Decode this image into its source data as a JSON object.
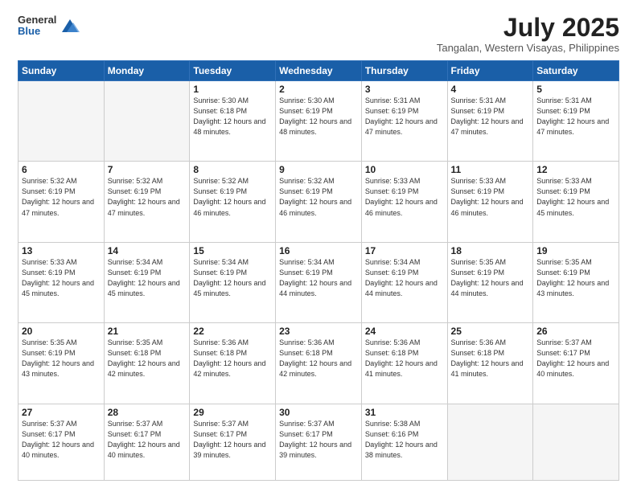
{
  "logo": {
    "general": "General",
    "blue": "Blue"
  },
  "header": {
    "month_year": "July 2025",
    "location": "Tangalan, Western Visayas, Philippines"
  },
  "weekdays": [
    "Sunday",
    "Monday",
    "Tuesday",
    "Wednesday",
    "Thursday",
    "Friday",
    "Saturday"
  ],
  "weeks": [
    [
      {
        "day": "",
        "info": ""
      },
      {
        "day": "",
        "info": ""
      },
      {
        "day": "1",
        "info": "Sunrise: 5:30 AM\nSunset: 6:18 PM\nDaylight: 12 hours and 48 minutes."
      },
      {
        "day": "2",
        "info": "Sunrise: 5:30 AM\nSunset: 6:19 PM\nDaylight: 12 hours and 48 minutes."
      },
      {
        "day": "3",
        "info": "Sunrise: 5:31 AM\nSunset: 6:19 PM\nDaylight: 12 hours and 47 minutes."
      },
      {
        "day": "4",
        "info": "Sunrise: 5:31 AM\nSunset: 6:19 PM\nDaylight: 12 hours and 47 minutes."
      },
      {
        "day": "5",
        "info": "Sunrise: 5:31 AM\nSunset: 6:19 PM\nDaylight: 12 hours and 47 minutes."
      }
    ],
    [
      {
        "day": "6",
        "info": "Sunrise: 5:32 AM\nSunset: 6:19 PM\nDaylight: 12 hours and 47 minutes."
      },
      {
        "day": "7",
        "info": "Sunrise: 5:32 AM\nSunset: 6:19 PM\nDaylight: 12 hours and 47 minutes."
      },
      {
        "day": "8",
        "info": "Sunrise: 5:32 AM\nSunset: 6:19 PM\nDaylight: 12 hours and 46 minutes."
      },
      {
        "day": "9",
        "info": "Sunrise: 5:32 AM\nSunset: 6:19 PM\nDaylight: 12 hours and 46 minutes."
      },
      {
        "day": "10",
        "info": "Sunrise: 5:33 AM\nSunset: 6:19 PM\nDaylight: 12 hours and 46 minutes."
      },
      {
        "day": "11",
        "info": "Sunrise: 5:33 AM\nSunset: 6:19 PM\nDaylight: 12 hours and 46 minutes."
      },
      {
        "day": "12",
        "info": "Sunrise: 5:33 AM\nSunset: 6:19 PM\nDaylight: 12 hours and 45 minutes."
      }
    ],
    [
      {
        "day": "13",
        "info": "Sunrise: 5:33 AM\nSunset: 6:19 PM\nDaylight: 12 hours and 45 minutes."
      },
      {
        "day": "14",
        "info": "Sunrise: 5:34 AM\nSunset: 6:19 PM\nDaylight: 12 hours and 45 minutes."
      },
      {
        "day": "15",
        "info": "Sunrise: 5:34 AM\nSunset: 6:19 PM\nDaylight: 12 hours and 45 minutes."
      },
      {
        "day": "16",
        "info": "Sunrise: 5:34 AM\nSunset: 6:19 PM\nDaylight: 12 hours and 44 minutes."
      },
      {
        "day": "17",
        "info": "Sunrise: 5:34 AM\nSunset: 6:19 PM\nDaylight: 12 hours and 44 minutes."
      },
      {
        "day": "18",
        "info": "Sunrise: 5:35 AM\nSunset: 6:19 PM\nDaylight: 12 hours and 44 minutes."
      },
      {
        "day": "19",
        "info": "Sunrise: 5:35 AM\nSunset: 6:19 PM\nDaylight: 12 hours and 43 minutes."
      }
    ],
    [
      {
        "day": "20",
        "info": "Sunrise: 5:35 AM\nSunset: 6:19 PM\nDaylight: 12 hours and 43 minutes."
      },
      {
        "day": "21",
        "info": "Sunrise: 5:35 AM\nSunset: 6:18 PM\nDaylight: 12 hours and 42 minutes."
      },
      {
        "day": "22",
        "info": "Sunrise: 5:36 AM\nSunset: 6:18 PM\nDaylight: 12 hours and 42 minutes."
      },
      {
        "day": "23",
        "info": "Sunrise: 5:36 AM\nSunset: 6:18 PM\nDaylight: 12 hours and 42 minutes."
      },
      {
        "day": "24",
        "info": "Sunrise: 5:36 AM\nSunset: 6:18 PM\nDaylight: 12 hours and 41 minutes."
      },
      {
        "day": "25",
        "info": "Sunrise: 5:36 AM\nSunset: 6:18 PM\nDaylight: 12 hours and 41 minutes."
      },
      {
        "day": "26",
        "info": "Sunrise: 5:37 AM\nSunset: 6:17 PM\nDaylight: 12 hours and 40 minutes."
      }
    ],
    [
      {
        "day": "27",
        "info": "Sunrise: 5:37 AM\nSunset: 6:17 PM\nDaylight: 12 hours and 40 minutes."
      },
      {
        "day": "28",
        "info": "Sunrise: 5:37 AM\nSunset: 6:17 PM\nDaylight: 12 hours and 40 minutes."
      },
      {
        "day": "29",
        "info": "Sunrise: 5:37 AM\nSunset: 6:17 PM\nDaylight: 12 hours and 39 minutes."
      },
      {
        "day": "30",
        "info": "Sunrise: 5:37 AM\nSunset: 6:17 PM\nDaylight: 12 hours and 39 minutes."
      },
      {
        "day": "31",
        "info": "Sunrise: 5:38 AM\nSunset: 6:16 PM\nDaylight: 12 hours and 38 minutes."
      },
      {
        "day": "",
        "info": ""
      },
      {
        "day": "",
        "info": ""
      }
    ]
  ]
}
